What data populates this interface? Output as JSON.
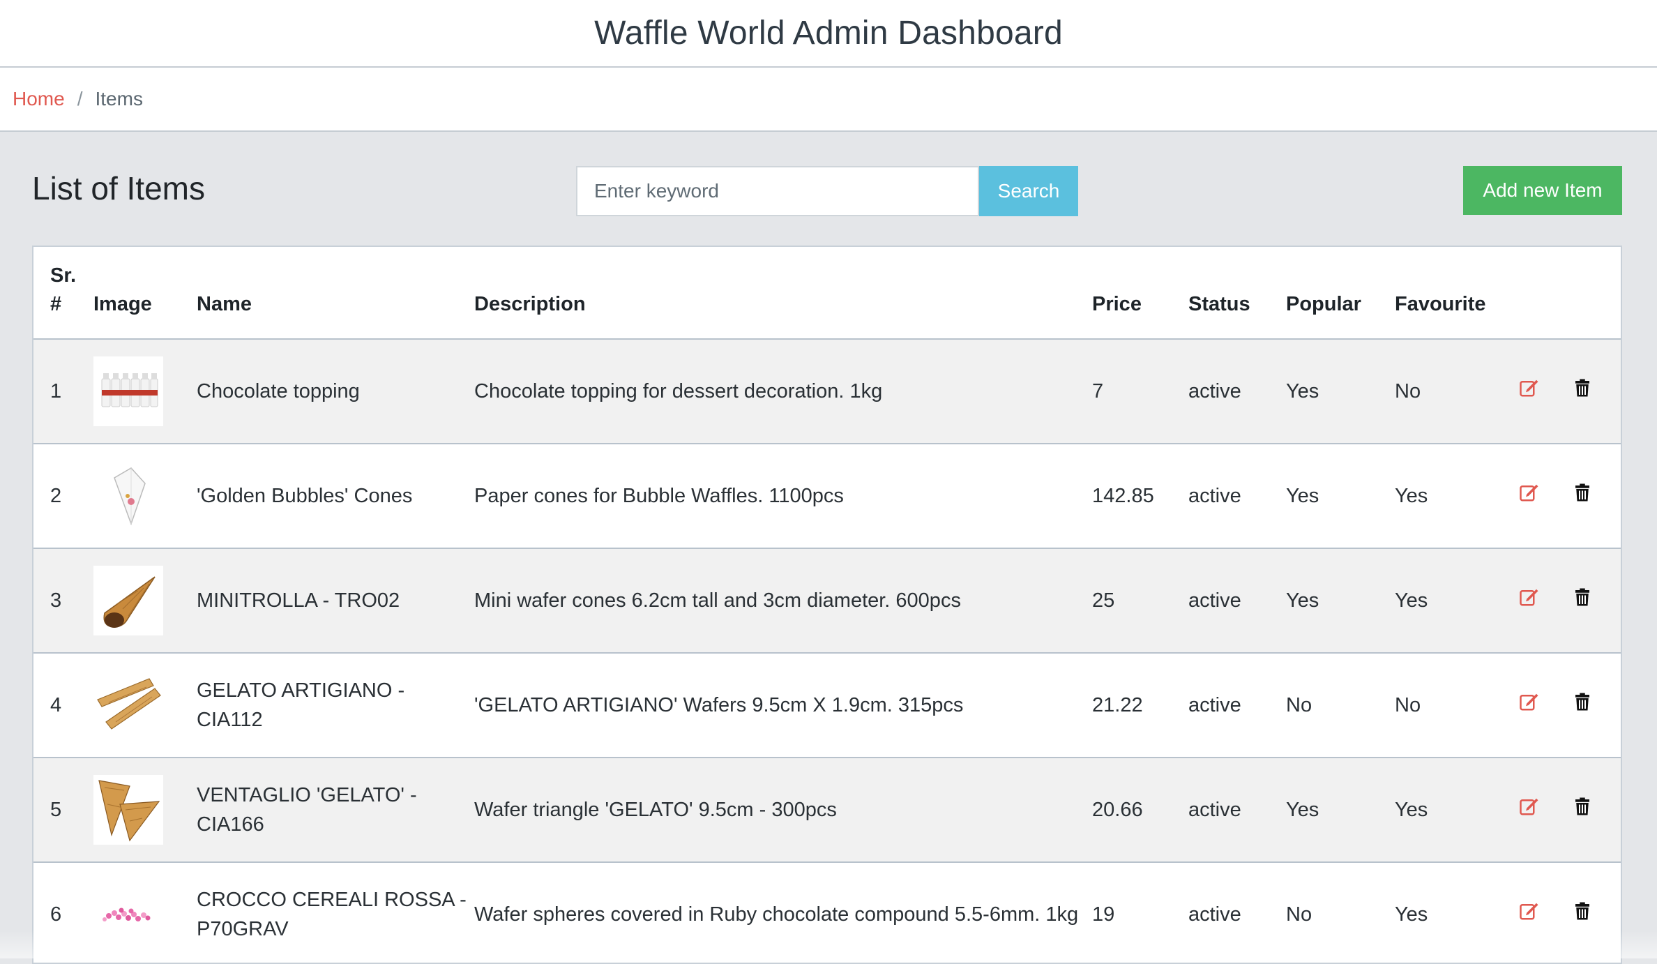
{
  "header": {
    "title": "Waffle World Admin Dashboard"
  },
  "breadcrumb": {
    "home": "Home",
    "separator": "/",
    "current": "Items"
  },
  "page": {
    "title": "List of Items"
  },
  "search": {
    "placeholder": "Enter keyword",
    "value": "",
    "button_label": "Search"
  },
  "actions": {
    "add_label": "Add new Item"
  },
  "table": {
    "columns": {
      "sr_line1": "Sr.",
      "sr_line2": "#",
      "image": "Image",
      "name": "Name",
      "description": "Description",
      "price": "Price",
      "status": "Status",
      "popular": "Popular",
      "favourite": "Favourite"
    },
    "rows": [
      {
        "sr": "1",
        "image_icon": "topping-bottles-image",
        "name": "Chocolate topping",
        "description": "Chocolate topping for dessert decoration. 1kg",
        "price": "7",
        "status": "active",
        "popular": "Yes",
        "favourite": "No"
      },
      {
        "sr": "2",
        "image_icon": "paper-cone-image",
        "name": "'Golden Bubbles' Cones",
        "description": "Paper cones for Bubble Waffles. 1100pcs",
        "price": "142.85",
        "status": "active",
        "popular": "Yes",
        "favourite": "Yes"
      },
      {
        "sr": "3",
        "image_icon": "wafer-cone-image",
        "name": "MINITROLLA - TRO02",
        "description": "Mini wafer cones 6.2cm tall and 3cm diameter. 600pcs",
        "price": "25",
        "status": "active",
        "popular": "Yes",
        "favourite": "Yes"
      },
      {
        "sr": "4",
        "image_icon": "wafer-sticks-image",
        "name": "GELATO ARTIGIANO - CIA112",
        "description": "'GELATO ARTIGIANO' Wafers 9.5cm X 1.9cm. 315pcs",
        "price": "21.22",
        "status": "active",
        "popular": "No",
        "favourite": "No"
      },
      {
        "sr": "5",
        "image_icon": "wafer-triangles-image",
        "name": "VENTAGLIO 'GELATO' - CIA166",
        "description": "Wafer triangle 'GELATO' 9.5cm - 300pcs",
        "price": "20.66",
        "status": "active",
        "popular": "Yes",
        "favourite": "Yes"
      },
      {
        "sr": "6",
        "image_icon": "pink-spheres-image",
        "name": "CROCCO CEREALI ROSSA - P70GRAV",
        "description": "Wafer spheres covered in Ruby chocolate compound 5.5-6mm. 1kg",
        "price": "19",
        "status": "active",
        "popular": "No",
        "favourite": "Yes"
      }
    ]
  },
  "colors": {
    "link": "#e0584f",
    "search_button": "#5bc0de",
    "add_button": "#4cb762",
    "edit_icon": "#e0584f",
    "delete_icon": "#111111"
  },
  "icons": {
    "edit": "edit-icon",
    "delete": "trash-icon"
  }
}
